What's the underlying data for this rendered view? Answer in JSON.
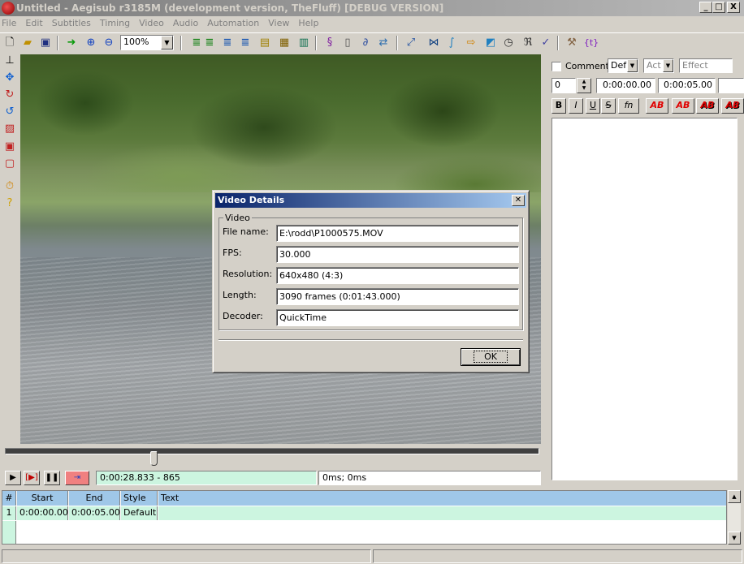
{
  "window": {
    "title": "Untitled - Aegisub r3185M (development version, TheFluff) [DEBUG VERSION]",
    "minimize_glyph": "_",
    "maximize_glyph": "□",
    "close_glyph": "X"
  },
  "menu": [
    "File",
    "Edit",
    "Subtitles",
    "Timing",
    "Video",
    "Audio",
    "Automation",
    "View",
    "Help"
  ],
  "toolbar": {
    "zoom_value": "100%"
  },
  "playback": {
    "position": "0:00:28.833 - 865",
    "offset": "0ms; 0ms"
  },
  "edit_panel": {
    "comment_label": "Comment",
    "style_value": "Def",
    "actor_placeholder": "Act",
    "effect_placeholder": "Effect",
    "layer_value": "0",
    "start_time": "0:00:00.00",
    "end_time": "0:00:05.00",
    "format_buttons": [
      "B",
      "I",
      "U",
      "S",
      "fn",
      "AB",
      "AB",
      "AB",
      "AB"
    ]
  },
  "grid": {
    "columns": [
      "#",
      "Start",
      "End",
      "Style",
      "Text"
    ],
    "rows": [
      {
        "num": "1",
        "start": "0:00:00.00",
        "end": "0:00:05.00",
        "style": "Default",
        "text": ""
      }
    ]
  },
  "dialog": {
    "title": "Video Details",
    "close_glyph": "✕",
    "group_label": "Video",
    "fields": [
      {
        "label": "File name:",
        "value": "E:\\rodd\\P1000575.MOV"
      },
      {
        "label": "FPS:",
        "value": "30.000"
      },
      {
        "label": "Resolution:",
        "value": "640x480 (4:3)"
      },
      {
        "label": "Length:",
        "value": "3090 frames (0:01:43.000)"
      },
      {
        "label": "Decoder:",
        "value": "QuickTime"
      }
    ],
    "ok_label": "OK"
  },
  "colors": {
    "dialog_title_start": "#0a246a",
    "dialog_title_end": "#a6caf0",
    "grid_header": "#9fc7e8",
    "active_row": "#ccf5e0"
  }
}
